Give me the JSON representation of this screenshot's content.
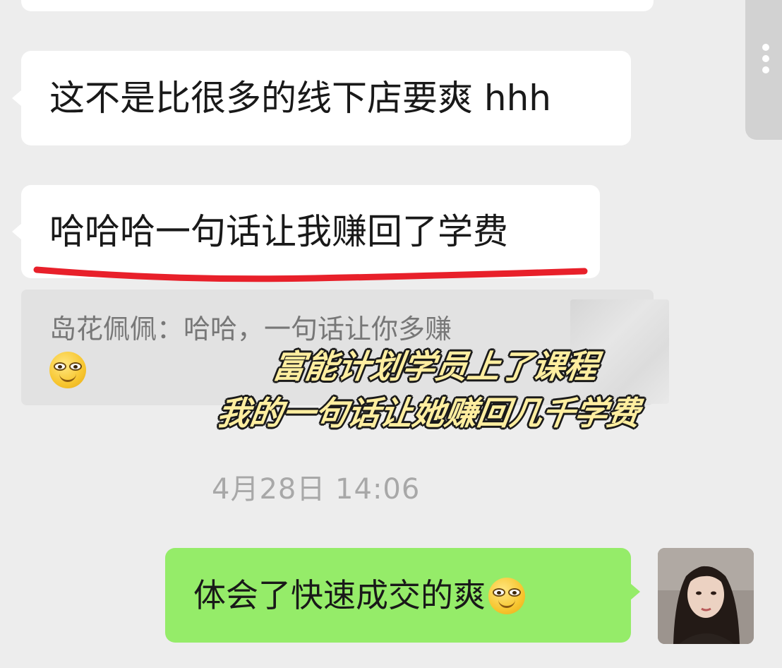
{
  "messages": [
    {
      "text": "这不是比很多的线下店要爽 hhh",
      "side": "left"
    },
    {
      "text": "哈哈哈一句话让我赚回了学费",
      "side": "left"
    }
  ],
  "quote": {
    "sender": "岛花佩佩：",
    "text": "哈哈，一句话让你多赚",
    "emoji": "grinning-face-emoji"
  },
  "overlay": {
    "line1": "富能计划学员上了课程",
    "line2": "我的一句话让她赚回几千学费"
  },
  "timestamp": "4月28日 14:06",
  "my_message": {
    "text": "体会了快速成交的爽",
    "emoji": "grinning-face-emoji"
  },
  "colors": {
    "background": "#ededed",
    "incoming_bubble": "#ffffff",
    "outgoing_bubble": "#95ec69",
    "underline": "#e8202a",
    "overlay_text": "#ffeea0"
  }
}
